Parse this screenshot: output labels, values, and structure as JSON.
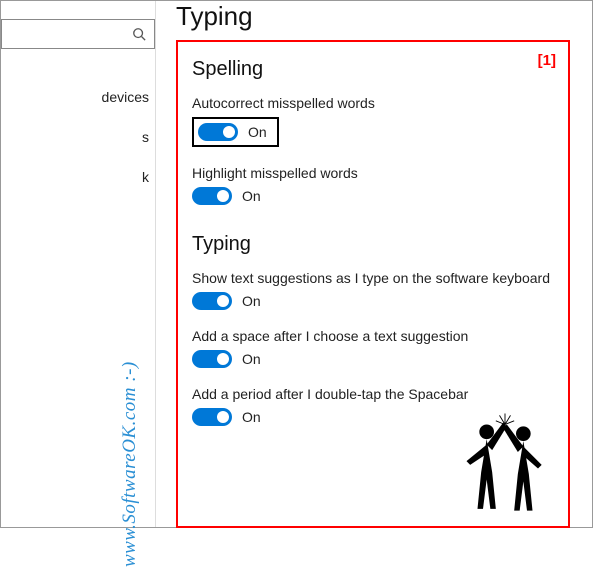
{
  "page_title": "Typing",
  "annotations": {
    "red_box_marker": "[1]"
  },
  "sidebar": {
    "search_placeholder": "",
    "items": [
      {
        "label": "devices"
      },
      {
        "label": "s"
      },
      {
        "label": "k"
      }
    ]
  },
  "sections": {
    "spelling": {
      "heading": "Spelling",
      "settings": [
        {
          "label": "Autocorrect misspelled words",
          "state": "On",
          "on": true,
          "highlighted": true
        },
        {
          "label": "Highlight misspelled words",
          "state": "On",
          "on": true,
          "highlighted": false
        }
      ]
    },
    "typing": {
      "heading": "Typing",
      "settings": [
        {
          "label": "Show text suggestions as I type on the software keyboard",
          "state": "On",
          "on": true
        },
        {
          "label": "Add a space after I choose a text suggestion",
          "state": "On",
          "on": true
        },
        {
          "label": "Add a period after I double-tap the Spacebar",
          "state": "On",
          "on": true
        }
      ]
    }
  },
  "watermark": "www.SoftwareOK.com :-)"
}
